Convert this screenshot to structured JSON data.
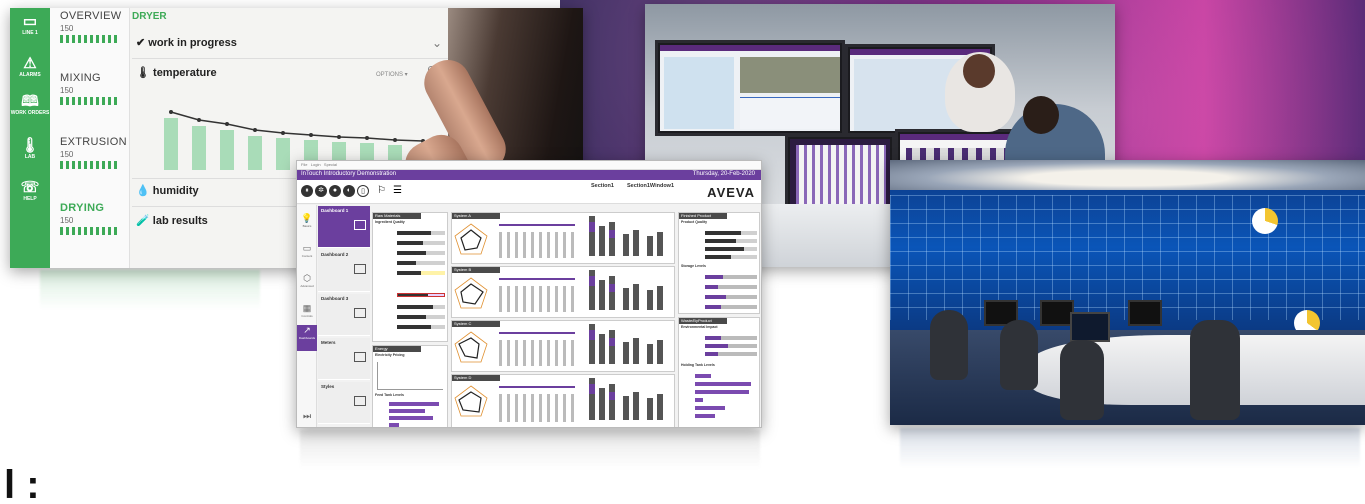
{
  "tablet": {
    "rail": [
      {
        "icon": "line-icon",
        "label": "LINE 1"
      },
      {
        "icon": "alarm-icon",
        "label": "ALARMS"
      },
      {
        "icon": "book-icon",
        "label": "WORK ORDERS"
      },
      {
        "icon": "thermometer-icon",
        "label": "LAB"
      },
      {
        "icon": "help-icon",
        "label": "HELP"
      }
    ],
    "items": [
      {
        "name": "OVERVIEW",
        "qty": "150"
      },
      {
        "name": "MIXING",
        "qty": "150"
      },
      {
        "name": "EXTRUSION",
        "qty": "150"
      },
      {
        "name": "DRYING",
        "qty": "150"
      }
    ],
    "section_title": "DRYER",
    "work_status": "work in progress",
    "temperature_label": "temperature",
    "options_label": "OPTIONS",
    "humidity_label": "humidity",
    "lab_results_label": "lab results",
    "accent": "#3daa57"
  },
  "hmi": {
    "app_title": "InTouch Introductory Demonstration",
    "date": "Thursday, 20-Feb-2020",
    "section_name": "Section1",
    "section_window": "Section1Window1",
    "logo": "AVEVA",
    "dashboards": [
      "Dashboard 1",
      "Dashboard 2",
      "Dashboard 3",
      "Meters",
      "Styles"
    ],
    "blocks": {
      "raw_materials": "Raw Materials",
      "ingredient_quality": "Ingredient Quality",
      "energy": "Energy",
      "electricity_pricing": "Electricity Pricing",
      "feed_tank_levels": "Feed Tank Levels",
      "system_a": "System A",
      "system_b": "System B",
      "system_c": "System C",
      "system_d": "System D",
      "finished_product": "Finished Product",
      "product_quality": "Product Quality",
      "storage_levels": "Storage Levels",
      "waste_by_product": "Waste/ByProduct",
      "environmental_impact": "Environmental Impact",
      "holding_tank_levels": "Holding Tank Levels"
    },
    "accent": "#6b3f9e"
  },
  "caption": "l :"
}
